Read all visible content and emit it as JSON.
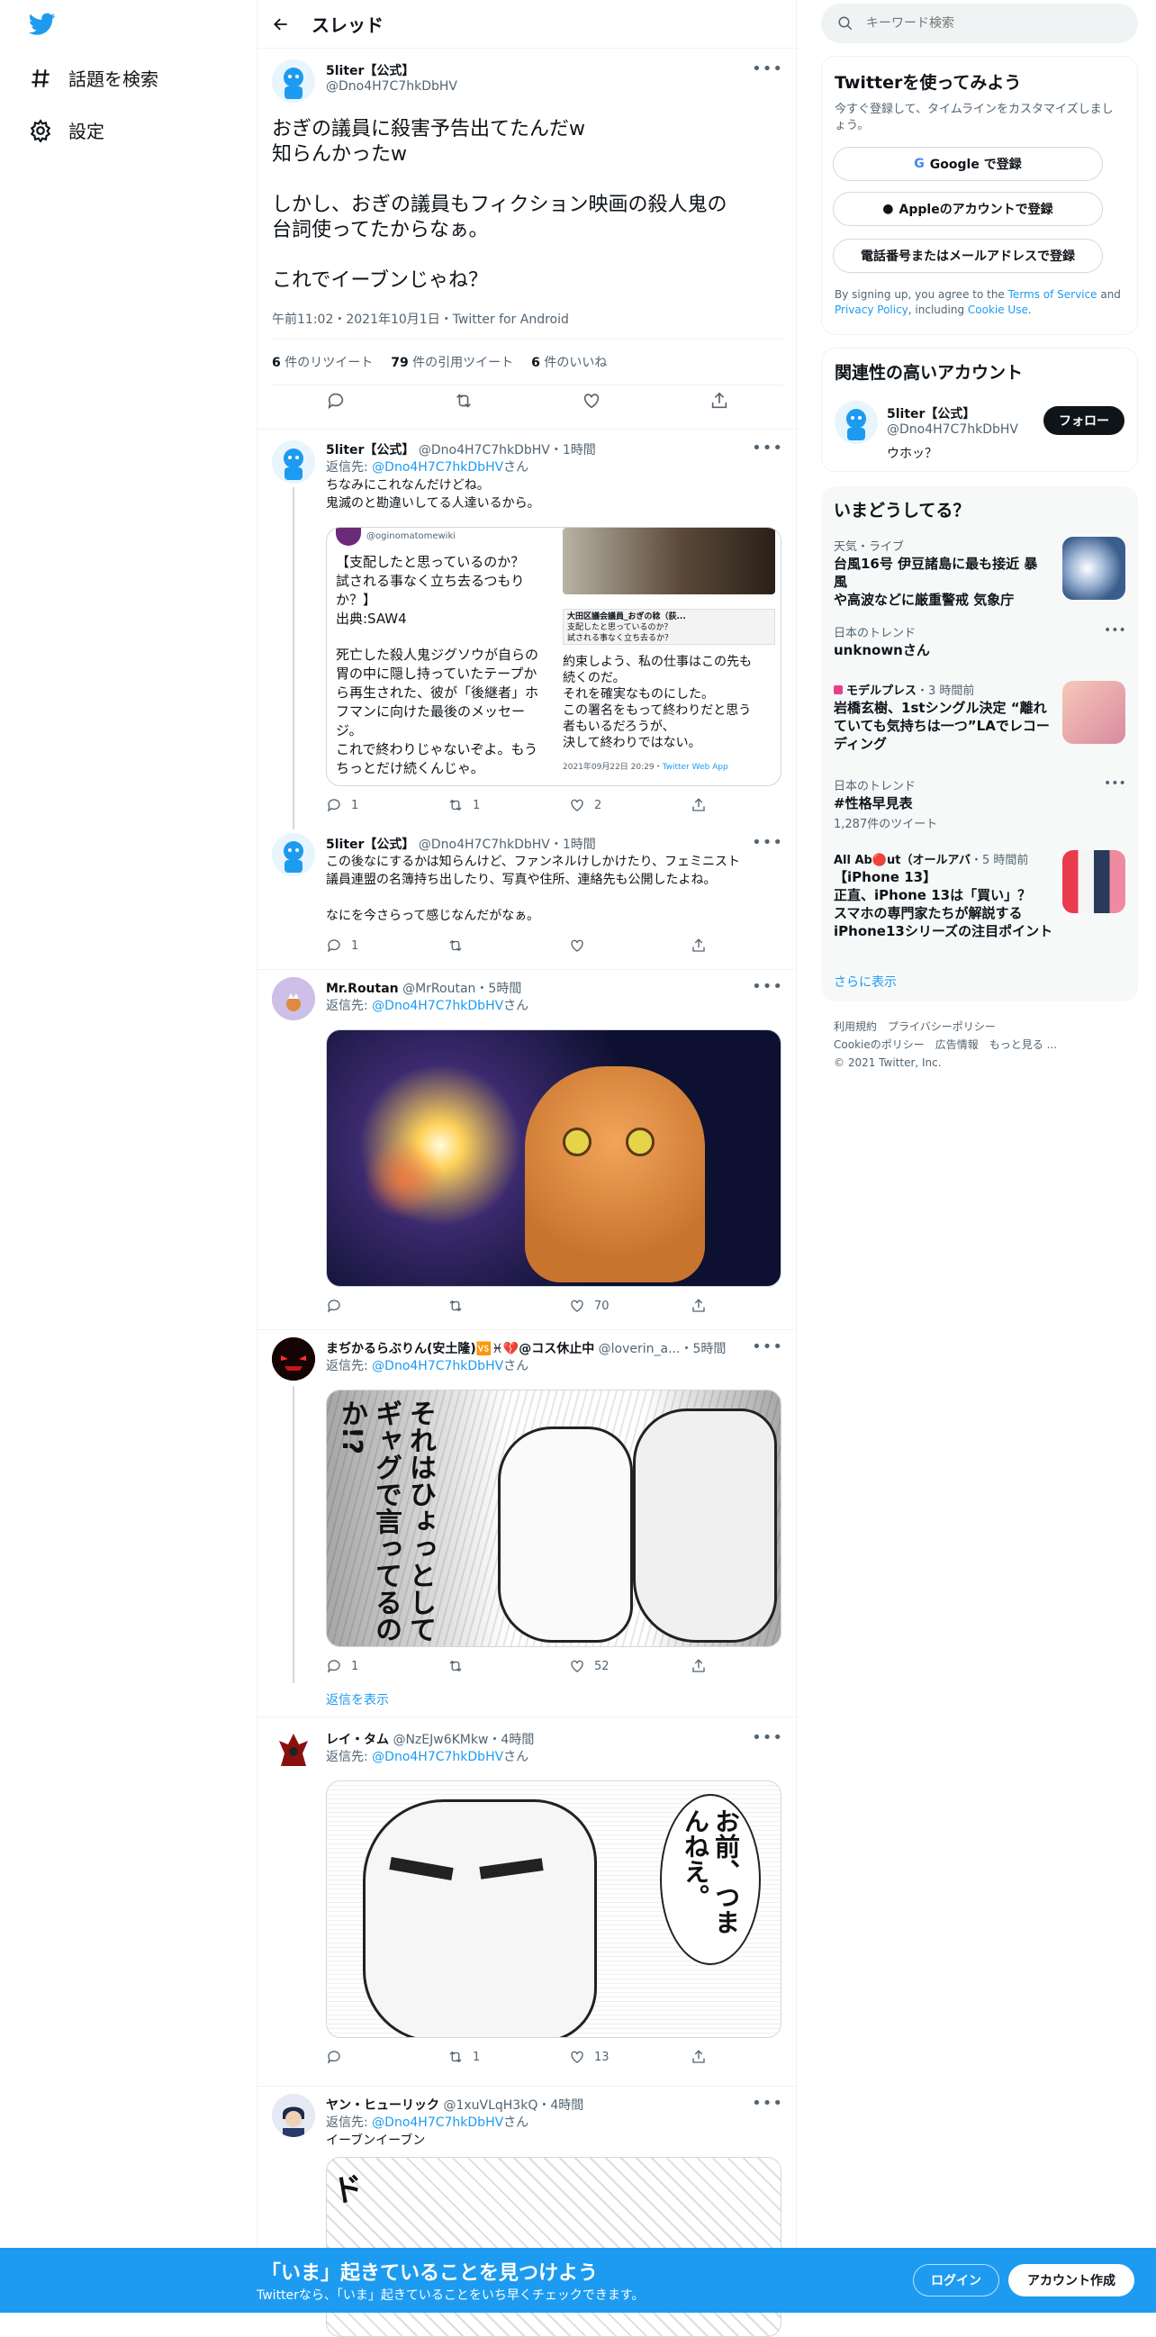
{
  "nav": {
    "explore": "話題を検索",
    "settings": "設定"
  },
  "header": {
    "title": "スレッド"
  },
  "main_tweet": {
    "name": "5liter【公式】",
    "handle": "@Dno4H7C7hkDbHV",
    "line1": "おぎの議員に殺害予告出てたんだw",
    "line2": "知らんかったw",
    "line3": "しかし、おぎの議員もフィクション映画の殺人鬼の",
    "line4": "台詞使ってたからなぁ。",
    "line5": "これでイーブンじゃね？",
    "meta": "午前11:02・2021年10月1日・Twitter for Android",
    "rt_count": "6",
    "rt_label": "件のリツイート",
    "qt_count": "79",
    "qt_label": "件の引用ツイート",
    "like_count": "6",
    "like_label": "件のいいね"
  },
  "replies": [
    {
      "name": "5liter【公式】",
      "handle": "@Dno4H7C7hkDbHV",
      "time": "・1時間",
      "reply_to_prefix": "返信先: ",
      "reply_to": "@Dno4H7C7hkDbHV",
      "reply_to_suffix": "さん",
      "line1": "ちなみにこれなんだけどね。",
      "line2": "鬼滅のと勘違いしてる人達いるから。",
      "card": {
        "handle": "@oginomatomewiki",
        "l1": "【支配したと思っているのか？",
        "l2": "試される事なく立ち去るつもり",
        "l3": "か？】",
        "l4": "出典:SAW4",
        "l5": "死亡した殺人鬼ジグソウが自らの",
        "l6": "胃の中に隠し持っていたテープか",
        "l7": "ら再生された、彼が「後継者」ホ",
        "l8": "フマンに向けた最後のメッセー",
        "l9": "ジ。",
        "l10": "これで終わりじゃないぞよ。もう",
        "l11": "ちっとだけ続くんじゃ。",
        "inner_title": "大田区議会議員_おぎの稔（荻...",
        "inner_q1": "支配したと思っているのか？",
        "inner_q2": "試される事なく立ち去るか？",
        "r1": "約束しよう、私の仕事はこの先も",
        "r2": "続くのだ。",
        "r3": "それを確実なものにした。",
        "r4": "この署名をもって終わりだと思う",
        "r5": "者もいるだろうが、",
        "r6": "決して終わりではない。",
        "date": "2021年09月22日 20:29・",
        "via": "Twitter Web App"
      },
      "reply": "1",
      "rt": "1",
      "like": "2"
    },
    {
      "name": "5liter【公式】",
      "handle": "@Dno4H7C7hkDbHV",
      "time": "・1時間",
      "line1": "この後なにするかは知らんけど、ファンネルけしかけたり、フェミニスト",
      "line2": "議員連盟の名簿持ち出したり、写真や住所、連絡先も公開したよね。",
      "line3": "なにを今さらって感じなんだがなぁ。",
      "reply": "1",
      "rt": "",
      "like": ""
    },
    {
      "name": "Mr.Routan",
      "handle": "@MrRoutan",
      "time": "・5時間",
      "reply_to_prefix": "返信先: ",
      "reply_to": "@Dno4H7C7hkDbHV",
      "reply_to_suffix": "さん",
      "reply": "",
      "rt": "",
      "like": "70"
    },
    {
      "name": "まぢかるらぶりん(安土隆)🆚♓💔@コス休止中",
      "handle": "@loverin_a...",
      "time": "・5時間",
      "reply_to_prefix": "返信先: ",
      "reply_to": "@Dno4H7C7hkDbHV",
      "reply_to_suffix": "さん",
      "manga": "それはひょっとしてギャグで言ってるのか!?",
      "reply": "1",
      "rt": "",
      "like": "52",
      "show_replies": "返信を表示"
    },
    {
      "name": "レイ・タム",
      "handle": "@NzEJw6KMkw",
      "time": "・4時間",
      "reply_to_prefix": "返信先: ",
      "reply_to": "@Dno4H7C7hkDbHV",
      "reply_to_suffix": "さん",
      "manga": "お前、つまんねえ。",
      "reply": "",
      "rt": "1",
      "like": "13"
    },
    {
      "name": "ヤン・ヒューリック",
      "handle": "@1xuVLqH3kQ",
      "time": "・4時間",
      "reply_to_prefix": "返信先: ",
      "reply_to": "@Dno4H7C7hkDbHV",
      "reply_to_suffix": "さん",
      "text": "イーブンイーブン"
    }
  ],
  "search": {
    "placeholder": "キーワード検索"
  },
  "signup": {
    "title": "Twitterを使ってみよう",
    "sub": "今すぐ登録して、タイムラインをカスタマイズしましょう。",
    "google": "Google で登録",
    "apple": "Appleのアカウントで登録",
    "phone": "電話番号またはメールアドレスで登録",
    "legal1": "By signing up, you agree to the ",
    "tos": "Terms of Service",
    "and": " and ",
    "privacy": "Privacy Policy",
    "inc": ", including ",
    "cookie": "Cookie Use",
    "dot": "."
  },
  "relevant": {
    "title": "関連性の高いアカウント",
    "name": "5liter【公式】",
    "handle": "@Dno4H7C7hkDbHV",
    "bio": "ウホッ？",
    "follow": "フォロー"
  },
  "trends": {
    "title": "いまどうしてる？",
    "t1_cat": "天気・ライブ",
    "t1_l1": "台風16号 伊豆諸島に最も接近 暴風",
    "t1_l2": "や高波などに厳重警戒 気象庁",
    "t2_cat": "日本のトレンド",
    "t2_title": "unknownさん",
    "t3_src": "モデルプレス",
    "t3_time": "・3 時間前",
    "t3_l1": "岩橋玄樹、1stシングル決定 “離れ",
    "t3_l2": "ていても気持ちは一つ”LAでレコー",
    "t3_l3": "ディング",
    "t4_cat": "日本のトレンド",
    "t4_title": "#性格早見表",
    "t4_count": "1,287件のツイート",
    "t5_src": "All Ab🔴ut（オールアバ",
    "t5_time": "・5 時間前",
    "t5_l1": "【iPhone 13】",
    "t5_l2": "正直、iPhone 13は「買い」？",
    "t5_l3": "スマホの専門家たちが解説する",
    "t5_l4": "iPhone13シリーズの注目ポイント",
    "more": "さらに表示"
  },
  "footer": {
    "l1": "利用規約",
    "l2": "プライバシーポリシー",
    "l3": "Cookieのポリシー",
    "l4": "広告情報",
    "l5": "もっと見る ...",
    "copy": "© 2021 Twitter, Inc."
  },
  "bottom": {
    "title": "「いま」起きていることを見つけよう",
    "sub": "Twitterなら、「いま」起きていることをいち早くチェックできます。",
    "login": "ログイン",
    "signup": "アカウント作成"
  }
}
